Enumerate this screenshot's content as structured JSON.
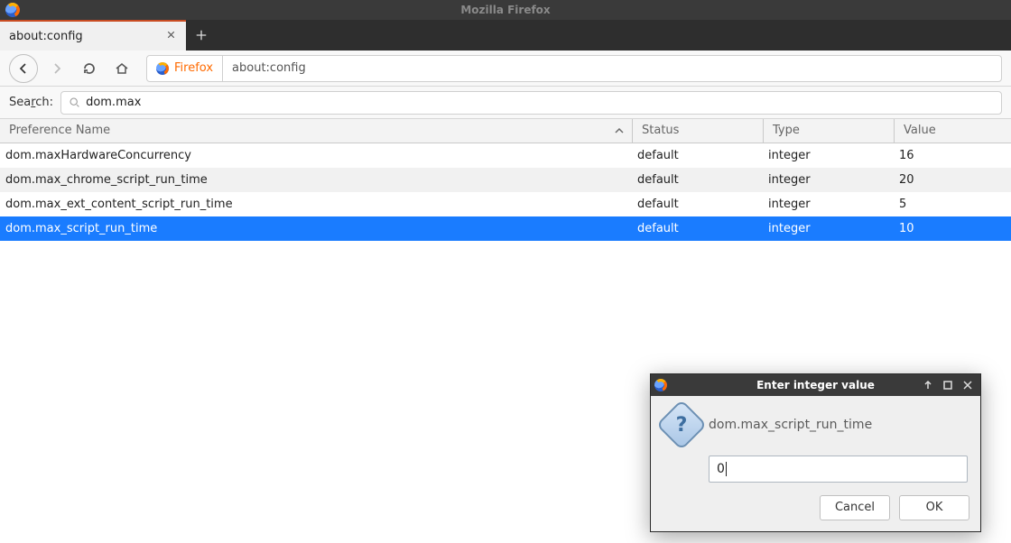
{
  "window": {
    "app_title": "Mozilla Firefox"
  },
  "tab": {
    "title": "about:config"
  },
  "urlbar": {
    "identity_label": "Firefox",
    "url": "about:config"
  },
  "search": {
    "label_pre": "Sea",
    "label_ul": "r",
    "label_post": "ch:",
    "query": "dom.max"
  },
  "table": {
    "columns": {
      "name": "Preference Name",
      "status": "Status",
      "type": "Type",
      "value": "Value"
    },
    "sort": {
      "column": "name",
      "dir": "asc"
    },
    "rows": [
      {
        "name": "dom.maxHardwareConcurrency",
        "status": "default",
        "type": "integer",
        "value": "16",
        "selected": false
      },
      {
        "name": "dom.max_chrome_script_run_time",
        "status": "default",
        "type": "integer",
        "value": "20",
        "selected": false
      },
      {
        "name": "dom.max_ext_content_script_run_time",
        "status": "default",
        "type": "integer",
        "value": "5",
        "selected": false
      },
      {
        "name": "dom.max_script_run_time",
        "status": "default",
        "type": "integer",
        "value": "10",
        "selected": true
      }
    ]
  },
  "dialog": {
    "title": "Enter integer value",
    "pref_name": "dom.max_script_run_time",
    "input_value": "0",
    "buttons": {
      "cancel": "Cancel",
      "ok": "OK"
    }
  }
}
